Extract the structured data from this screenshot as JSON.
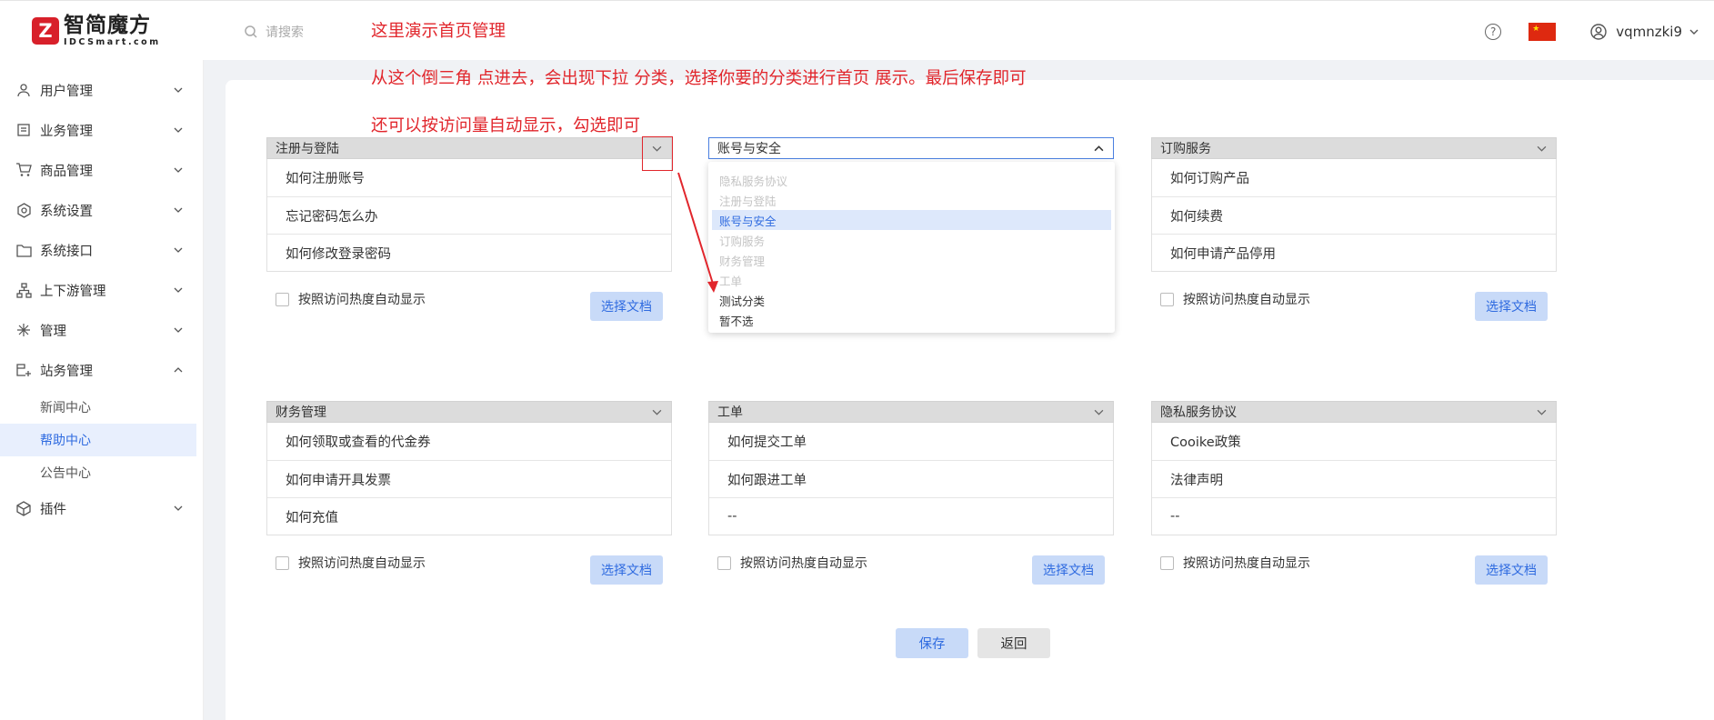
{
  "header": {
    "logo_cn": "智简魔方",
    "logo_en": "IDCSmart.com",
    "search_placeholder": "请搜索",
    "username": "vqmnzki9"
  },
  "annotations": {
    "line1": "这里演示首页管理",
    "line2": "从这个倒三角 点进去，会出现下拉 分类，选择你要的分类进行首页 展示。最后保存即可",
    "line3": "还可以按访问量自动显示，勾选即可"
  },
  "sidebar": {
    "items": [
      {
        "label": "用户管理",
        "icon": "user-icon"
      },
      {
        "label": "业务管理",
        "icon": "document-icon"
      },
      {
        "label": "商品管理",
        "icon": "cart-icon"
      },
      {
        "label": "系统设置",
        "icon": "gear-icon"
      },
      {
        "label": "系统接口",
        "icon": "folder-icon"
      },
      {
        "label": "上下游管理",
        "icon": "network-icon"
      },
      {
        "label": "管理",
        "icon": "sparkle-icon"
      },
      {
        "label": "站务管理",
        "icon": "site-icon"
      },
      {
        "label": "插件",
        "icon": "cube-icon"
      }
    ],
    "sub_items": [
      "新闻中心",
      "帮助中心",
      "公告中心"
    ],
    "active_sub": "帮助中心"
  },
  "cards": [
    {
      "title": "注册与登陆",
      "rows": [
        "如何注册账号",
        "忘记密码怎么办",
        "如何修改登录密码"
      ]
    },
    {
      "title": "账号与安全",
      "rows": []
    },
    {
      "title": "订购服务",
      "rows": [
        "如何订购产品",
        "如何续费",
        "如何申请产品停用"
      ]
    },
    {
      "title": "财务管理",
      "rows": [
        "如何领取或查看的代金券",
        "如何申请开具发票",
        "如何充值"
      ]
    },
    {
      "title": "工单",
      "rows": [
        "如何提交工单",
        "如何跟进工单",
        "--"
      ]
    },
    {
      "title": "隐私服务协议",
      "rows": [
        "Cooike政策",
        "法律声明",
        "--"
      ]
    }
  ],
  "checkbox_label": "按照访问热度自动显示",
  "choose_doc_label": "选择文档",
  "dropdown": {
    "options": [
      "隐私服务协议",
      "注册与登陆",
      "账号与安全",
      "订购服务",
      "财务管理",
      "工单",
      "测试分类",
      "暂不选"
    ],
    "selected": "账号与安全"
  },
  "buttons": {
    "save": "保存",
    "back": "返回"
  },
  "colors": {
    "accent": "#2f6be0",
    "annotation": "#e1262c",
    "brand": "#d8202a"
  }
}
